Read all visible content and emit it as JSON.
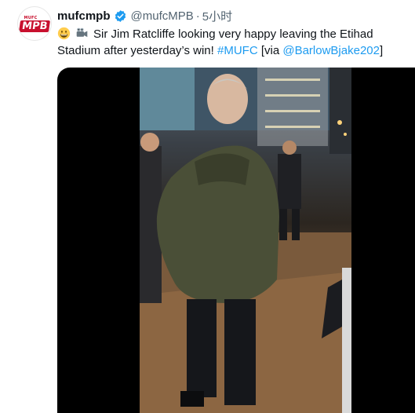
{
  "tweet": {
    "display_name": "mufcmpb",
    "handle": "@mufcMPB",
    "separator": "·",
    "time": "5小时",
    "text_part1": "Sir Jim Ratcliffe looking very happy leaving the Etihad Stadium after yesterday’s win! ",
    "hashtag": "#MUFC",
    "text_part2": " [via ",
    "mention": "@BarlowBjake202",
    "text_part3": "]"
  },
  "avatar": {
    "small_text": "MUFC",
    "big_text": "MPB"
  },
  "icons": {
    "verified": "verified-badge-icon",
    "emoji_grin": "grinning-face-emoji",
    "emoji_camera": "video-camera-emoji"
  },
  "colors": {
    "link": "#1d9bf0",
    "secondary_text": "#536471",
    "avatar_red": "#c8102e"
  }
}
